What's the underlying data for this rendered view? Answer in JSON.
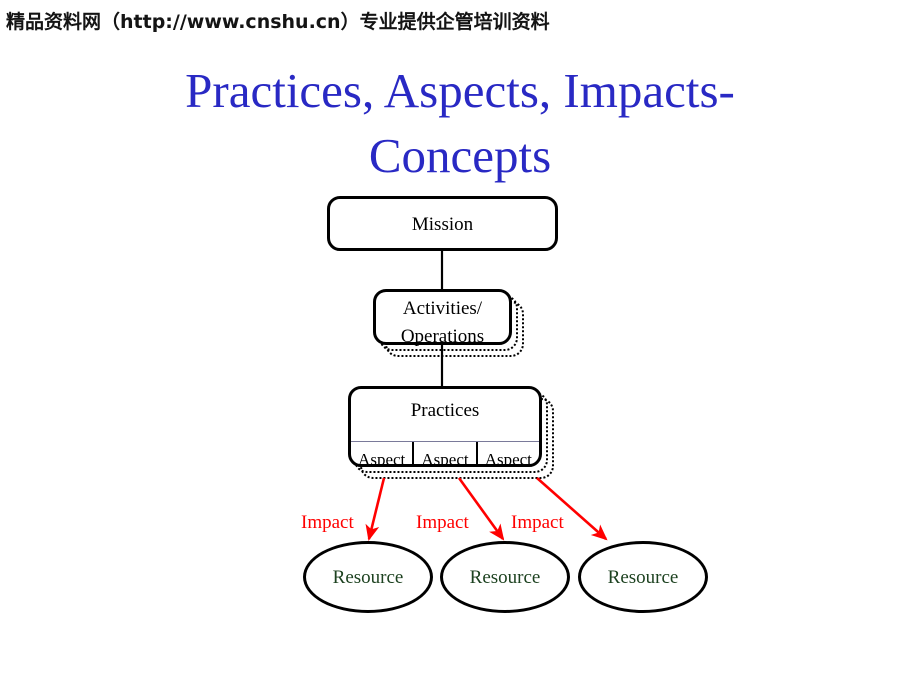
{
  "watermark": {
    "text": "精品资料网（http://www.cnshu.cn）专业提供企管培训资料"
  },
  "title": {
    "line1": "Practices, Aspects, Impacts-",
    "line2": "Concepts",
    "color": "#2929c4"
  },
  "diagram": {
    "mission": {
      "label": "Mission"
    },
    "activities": {
      "label_line1": "Activities/",
      "label_line2": "Operations"
    },
    "practices": {
      "header": "Practices",
      "aspects": [
        "Aspect",
        "Aspect",
        "Aspect"
      ]
    },
    "impacts": [
      "Impact",
      "Impact",
      "Impact"
    ],
    "resources": [
      "Resource",
      "Resource",
      "Resource"
    ],
    "colors": {
      "arrow": "#ff0000",
      "impact_text": "#ff0000",
      "resource_text": "#1d4220",
      "box_border": "#000000",
      "connector": "#000000"
    }
  }
}
